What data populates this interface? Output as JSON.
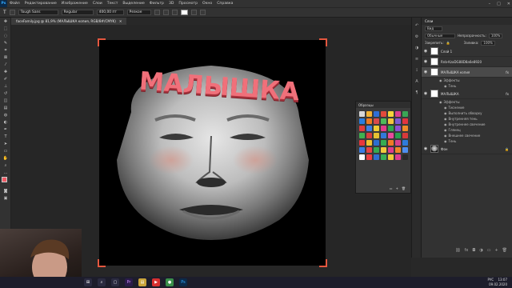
{
  "menubar": {
    "logo": "Ps",
    "items": [
      "Файл",
      "Редактирование",
      "Изображение",
      "Слои",
      "Текст",
      "Выделение",
      "Фильтр",
      "3D",
      "Просмотр",
      "Окно",
      "Справка"
    ],
    "window_controls": [
      "–",
      "□",
      "✕"
    ]
  },
  "options_bar": {
    "font_family": "Tough Sans",
    "font_style": "Regular",
    "font_size": "400,00 пт",
    "antialias": "Резкое"
  },
  "document": {
    "tab_title": "faceFamily.jpg @ 81,9% (МАЛЫШКА копия, RGB/8#/CMYK)",
    "close": "✕",
    "headline": "МАЛЫШКА"
  },
  "swatches_panel": {
    "title": "Образцы",
    "colors": [
      "#d7d7d7",
      "#f2b233",
      "#2e6fd6",
      "#e24a3c",
      "#f5d43a",
      "#d93f8f",
      "#3aa655",
      "#2a7de1",
      "#f07a1f",
      "#d94a4a",
      "#4dbb5a",
      "#f2c53d",
      "#7a5bd6",
      "#e2353f",
      "#e43b3b",
      "#3f7ee3",
      "#f1cc33",
      "#e33b8a",
      "#2fa84f",
      "#8b4fd6",
      "#f08b28",
      "#3fb14f",
      "#d73d3d",
      "#e5c032",
      "#3279d9",
      "#e84a9c",
      "#27a04d",
      "#d83a3a",
      "#e9373b",
      "#f0c230",
      "#2d6ecf",
      "#36ad52",
      "#f07a26",
      "#d7408d",
      "#2e7bdc",
      "#3b7de5",
      "#e64444",
      "#35a950",
      "#f2c93c",
      "#de3b8d",
      "#f18627",
      "#4e8ff0",
      "#ffffff",
      "#ef3f3f",
      "#2f6fd0",
      "#3aae56",
      "#f2c83a",
      "#de3d8f",
      "#2a2a2a"
    ]
  },
  "layers_panel": {
    "tab": "Слои",
    "search_label": "Вид",
    "blend_mode": "Обычные",
    "opacity_label": "Непрозрачность:",
    "opacity_value": "100%",
    "lock_label": "Закрепить:",
    "fill_label": "Заливка:",
    "fill_value": "100%",
    "layers": [
      {
        "name": "Слой 1",
        "thumb": "white"
      },
      {
        "name": "Rnb-KzaDG88D8a6e8920",
        "thumb": "white"
      },
      {
        "name": "МАЛЫШКА копия",
        "thumb": "white",
        "selected": true
      },
      {
        "name": "МАЛЫШКА",
        "thumb": "white"
      },
      {
        "name": "Фон",
        "thumb": "face"
      }
    ],
    "fx_copy": [
      "Эффекты",
      "Тень"
    ],
    "fx_main": [
      "Эффекты",
      "Тиснение",
      "Выполнить обводку",
      "Внутренняя тень",
      "Внутреннее свечение",
      "Глянец",
      "Внешнее свечение",
      "Тень"
    ]
  },
  "status_bar": {
    "zoom": "81,9%"
  },
  "taskbar": {
    "time": "13:07",
    "date": "09.02.2020",
    "lang": "РУС"
  }
}
